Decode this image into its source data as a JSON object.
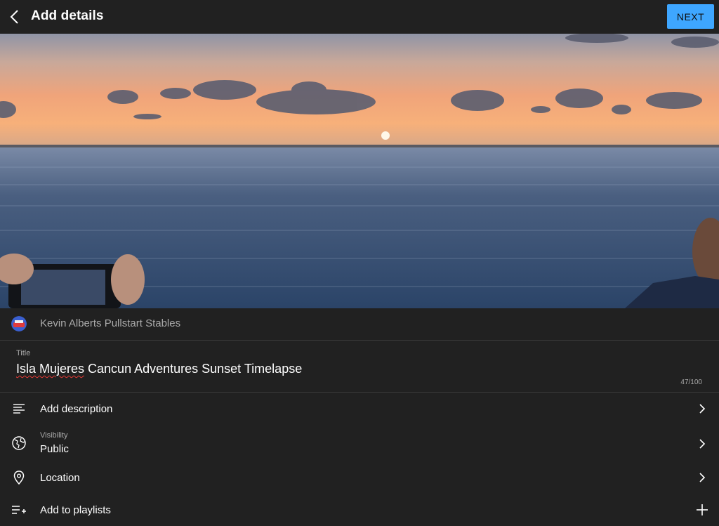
{
  "header": {
    "title": "Add details",
    "next_label": "NEXT",
    "back_icon": "chevron-left-icon"
  },
  "channel": {
    "name": "Kevin Alberts Pullstart Stables"
  },
  "title_field": {
    "label": "Title",
    "value_misspelled": "Isla Mujeres",
    "value_rest": " Cancun Adventures Sunset Timelapse",
    "char_count": "47/100"
  },
  "rows": {
    "description": {
      "label": "Add description",
      "icon": "description-lines-icon"
    },
    "visibility": {
      "label": "Visibility",
      "value": "Public",
      "icon": "globe-icon"
    },
    "location": {
      "label": "Location",
      "icon": "location-pin-icon"
    },
    "playlists": {
      "label": "Add to playlists",
      "icon": "playlist-add-icon"
    }
  },
  "colors": {
    "background": "#212121",
    "accent": "#3ea6ff",
    "secondary_text": "#aaaaaa"
  }
}
